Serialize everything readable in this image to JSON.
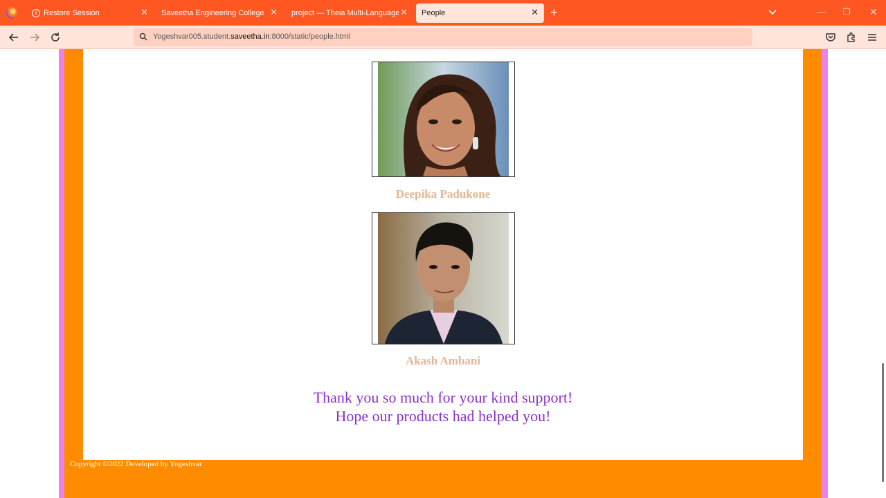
{
  "browser": {
    "tabs": [
      {
        "label": "Restore Session",
        "active": false,
        "icon": "info-icon"
      },
      {
        "label": "Saveetha Engineering College",
        "active": false
      },
      {
        "label": "project — Theia Multi-Language Ex",
        "active": false
      },
      {
        "label": "People",
        "active": true
      }
    ],
    "url_prefix": "Yogeshvar005.student.",
    "url_domain": "saveetha.in",
    "url_suffix": ":8000/static/people.html",
    "accent_color": "#ff5722"
  },
  "page": {
    "people": [
      {
        "name": "Deepika Padukone",
        "photo": "portrait-woman"
      },
      {
        "name": "Akash Ambani",
        "photo": "portrait-man"
      }
    ],
    "thanks_line1": "Thank you so much for your kind support!",
    "thanks_line2": "Hope our products had helped you!",
    "footer": "Copyright ©2022 Developed by Yogeshvar",
    "colors": {
      "border_outer": "#ea82ea",
      "border_inner": "#ff8c00",
      "name_color": "#e0b896",
      "thanks_color": "#8b2fc9"
    }
  }
}
